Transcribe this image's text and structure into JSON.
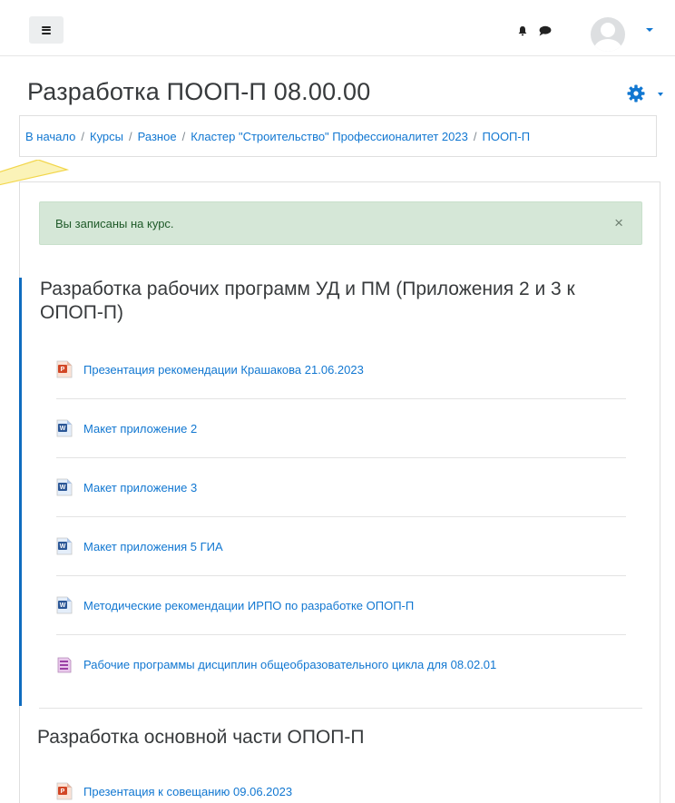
{
  "navbar": {
    "menu_button": "hamburger-icon",
    "notification_icon": "bell-icon",
    "messages_icon": "chat-icon",
    "user_avatar": "avatar",
    "accent": "#1177d1"
  },
  "page": {
    "title": "Разработка ПООП-П 08.00.00",
    "settings_icon": "gear-icon"
  },
  "breadcrumb": [
    "В начало",
    "Курсы",
    "Разное",
    "Кластер \"Строительство\" Профессионалитет 2023",
    "ПООП-П"
  ],
  "alert": {
    "message": "Вы записаны на курс.",
    "close": "×"
  },
  "sections": [
    {
      "title": "Разработка рабочих программ УД и ПМ (Приложения 2 и 3 к ОПОП-П)",
      "activities": [
        {
          "icon": "powerpoint-icon",
          "label": "Презентация рекомендации Крашакова 21.06.2023"
        },
        {
          "icon": "word-icon",
          "label": "Макет приложение 2"
        },
        {
          "icon": "word-icon",
          "label": "Макет приложение 3"
        },
        {
          "icon": "word-icon",
          "label": "Макет приложения 5 ГИА"
        },
        {
          "icon": "word-icon",
          "label": "Методические рекомендации ИРПО по разработке ОПОП-П"
        },
        {
          "icon": "folder-icon",
          "label": "Рабочие программы дисциплин общеобразовательного цикла для 08.02.01"
        }
      ]
    },
    {
      "title": "Разработка основной части ОПОП-П",
      "activities": [
        {
          "icon": "powerpoint-icon",
          "label": "Презентация к совещанию 09.06.2023"
        }
      ]
    }
  ],
  "colors": {
    "link": "#1177d1",
    "alert_bg": "#d5e7d7",
    "current_section_border": "#0f6cbf",
    "tour_hint": "#f7e46a"
  }
}
